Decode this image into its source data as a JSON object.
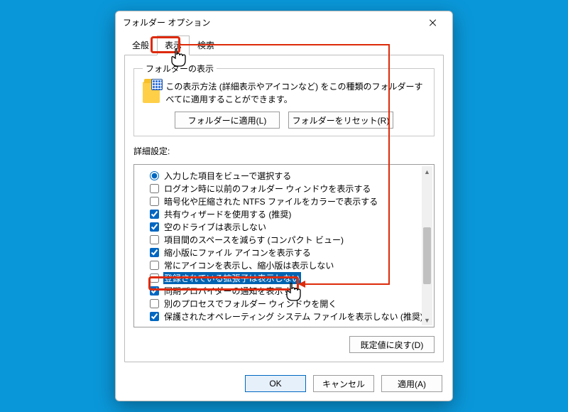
{
  "window": {
    "title": "フォルダー オプション"
  },
  "tabs": {
    "general": "全般",
    "view": "表示",
    "search": "検索"
  },
  "folderView": {
    "legend": "フォルダーの表示",
    "desc": "この表示方法 (詳細表示やアイコンなど) をこの種類のフォルダーすべてに適用することができます。",
    "applyBtn": "フォルダーに適用(L)",
    "resetBtn": "フォルダーをリセット(R)"
  },
  "advanced": {
    "label": "詳細設定:",
    "items": [
      {
        "type": "radio",
        "checked": true,
        "label": "入力した項目をビューで選択する"
      },
      {
        "type": "checkbox",
        "checked": false,
        "label": "ログオン時に以前のフォルダー ウィンドウを表示する"
      },
      {
        "type": "checkbox",
        "checked": false,
        "label": "暗号化や圧縮された NTFS ファイルをカラーで表示する"
      },
      {
        "type": "checkbox",
        "checked": true,
        "label": "共有ウィザードを使用する (推奨)"
      },
      {
        "type": "checkbox",
        "checked": true,
        "label": "空のドライブは表示しない"
      },
      {
        "type": "checkbox",
        "checked": false,
        "label": "項目間のスペースを減らす (コンパクト ビュー)"
      },
      {
        "type": "checkbox",
        "checked": true,
        "label": "縮小版にファイル アイコンを表示する"
      },
      {
        "type": "checkbox",
        "checked": false,
        "label": "常にアイコンを表示し、縮小版は表示しない"
      },
      {
        "type": "checkbox",
        "checked": false,
        "label": "登録されている拡張子は表示しない",
        "selected": true
      },
      {
        "type": "checkbox",
        "checked": true,
        "label": "同期プロバイダーの通知を表示する"
      },
      {
        "type": "checkbox",
        "checked": false,
        "label": "別のプロセスでフォルダー ウィンドウを開く"
      },
      {
        "type": "checkbox",
        "checked": true,
        "label": "保護されたオペレーティング システム ファイルを表示しない (推奨)"
      }
    ],
    "restoreBtn": "既定値に戻す(D)"
  },
  "footer": {
    "ok": "OK",
    "cancel": "キャンセル",
    "apply": "適用(A)"
  }
}
